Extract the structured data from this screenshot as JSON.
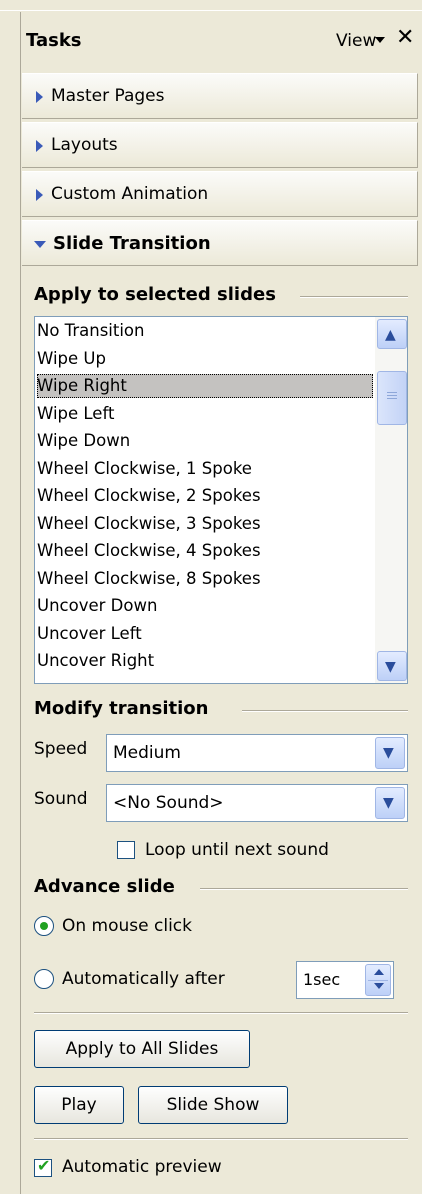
{
  "header": {
    "title": "Tasks",
    "view_label": "View",
    "close_glyph": "✕"
  },
  "sections": {
    "master_pages": "Master Pages",
    "layouts": "Layouts",
    "custom_animation": "Custom Animation",
    "slide_transition": "Slide Transition"
  },
  "apply_group": {
    "label": "Apply to selected slides",
    "selected_index": 2,
    "items": [
      "No Transition",
      "Wipe Up",
      "Wipe Right",
      "Wipe Left",
      "Wipe Down",
      "Wheel Clockwise, 1 Spoke",
      "Wheel Clockwise, 2 Spokes",
      "Wheel Clockwise, 3 Spokes",
      "Wheel Clockwise, 4 Spokes",
      "Wheel Clockwise, 8 Spokes",
      "Uncover Down",
      "Uncover Left",
      "Uncover Right"
    ]
  },
  "modify_group": {
    "label": "Modify transition",
    "speed_label": "Speed",
    "speed_value": "Medium",
    "sound_label": "Sound",
    "sound_value": "<No Sound>",
    "loop_label": "Loop until next sound",
    "loop_checked": false
  },
  "advance_group": {
    "label": "Advance slide",
    "on_click_label": "On mouse click",
    "auto_label": "Automatically after",
    "auto_value": "1sec",
    "selected": "on_click"
  },
  "buttons": {
    "apply_all": "Apply to All Slides",
    "play": "Play",
    "slide_show": "Slide Show"
  },
  "preview": {
    "label": "Automatic preview",
    "checked": true
  },
  "colors": {
    "accent": "#21a121",
    "panel": "#ece9d8",
    "border": "#7f9db9"
  },
  "icons": {
    "close": "close-icon",
    "view_menu": "chevron-down-icon",
    "section_collapsed": "triangle-right-icon",
    "section_expanded": "triangle-down-icon"
  }
}
